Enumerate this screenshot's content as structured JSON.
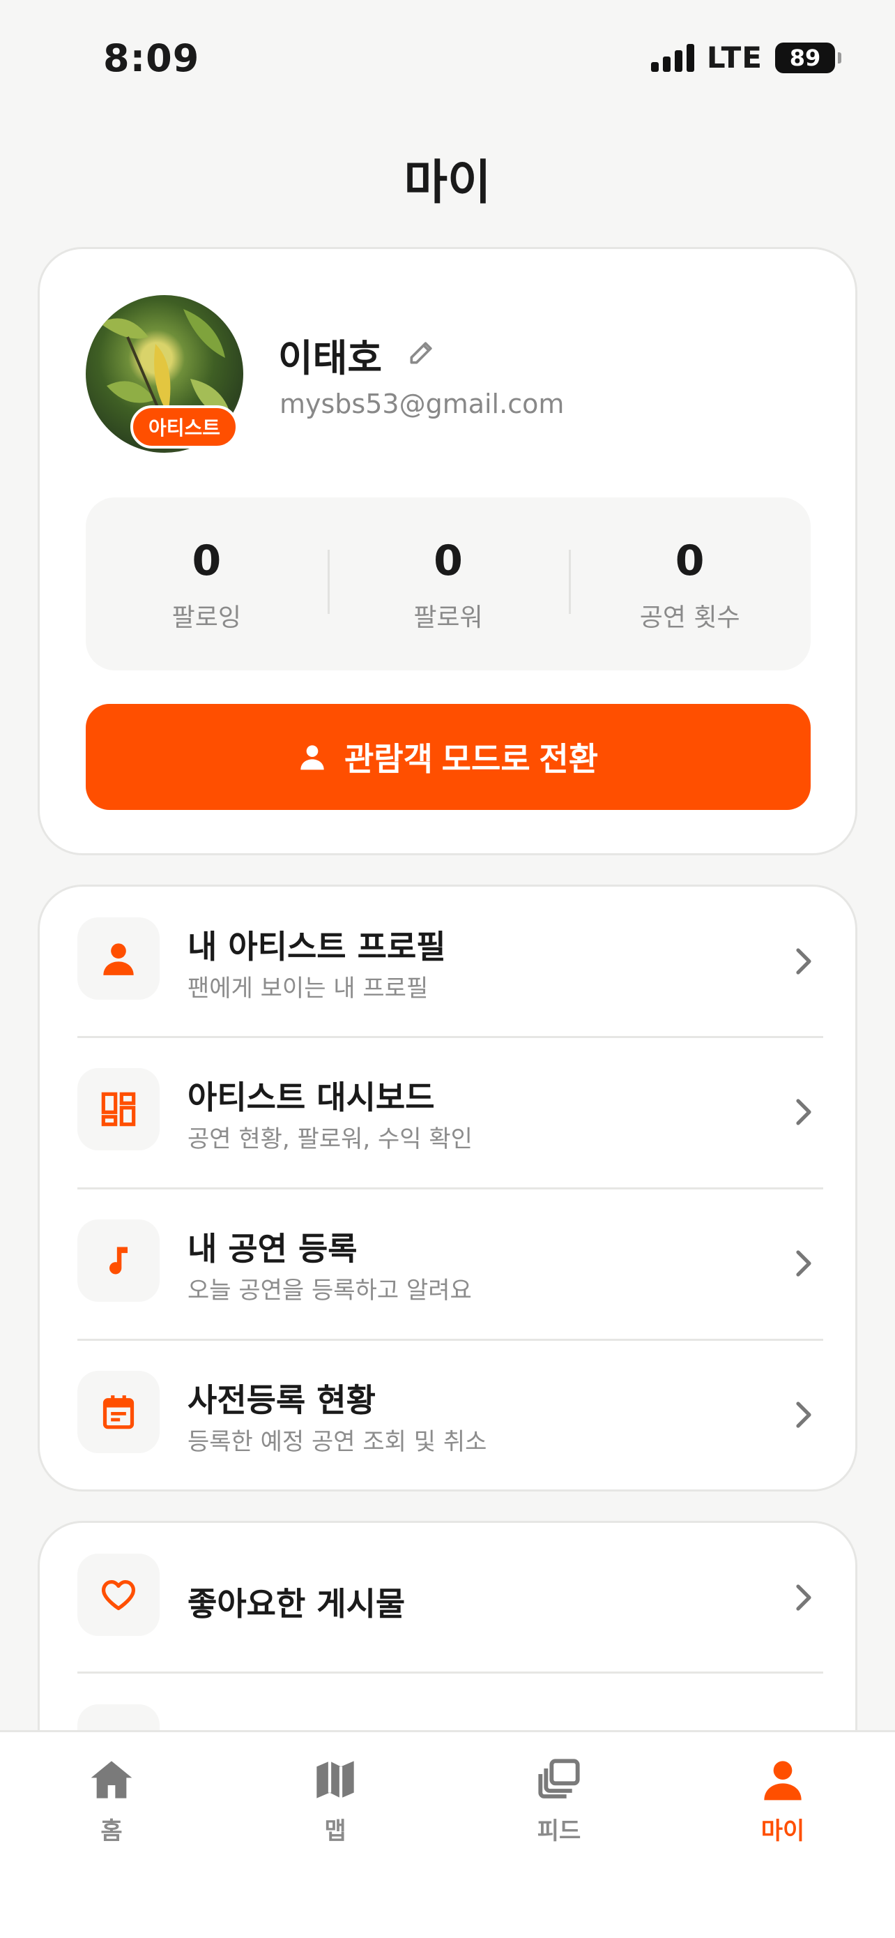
{
  "status_bar": {
    "time": "8:09",
    "network": "LTE",
    "battery": "89"
  },
  "page_title": "마이",
  "profile": {
    "name": "이태호",
    "email": "mysbs53@gmail.com",
    "badge": "아티스트"
  },
  "stats": [
    {
      "value": "0",
      "label": "팔로잉"
    },
    {
      "value": "0",
      "label": "팔로워"
    },
    {
      "value": "0",
      "label": "공연 횟수"
    }
  ],
  "mode_button": {
    "label": "관람객 모드로 전환"
  },
  "artist_menu": [
    {
      "title": "내 아티스트 프로필",
      "subtitle": "팬에게 보이는 내 프로필",
      "icon": "person-icon"
    },
    {
      "title": "아티스트 대시보드",
      "subtitle": "공연 현황, 팔로워, 수익 확인",
      "icon": "dashboard-icon"
    },
    {
      "title": "내 공연 등록",
      "subtitle": "오늘 공연을 등록하고 알려요",
      "icon": "music-note-icon"
    },
    {
      "title": "사전등록 현황",
      "subtitle": "등록한 예정 공연 조회 및 취소",
      "icon": "calendar-icon"
    }
  ],
  "general_menu": [
    {
      "title": "좋아요한 게시물",
      "icon": "heart-icon"
    }
  ],
  "tab_bar": {
    "tabs": [
      {
        "label": "홈",
        "icon": "home-icon",
        "active": false
      },
      {
        "label": "맵",
        "icon": "map-icon",
        "active": false
      },
      {
        "label": "피드",
        "icon": "feed-icon",
        "active": false
      },
      {
        "label": "마이",
        "icon": "person-icon",
        "active": true
      }
    ]
  },
  "colors": {
    "accent": "#ff4f00",
    "background": "#f6f6f5",
    "card": "#ffffff",
    "muted_text": "#8a8a8a"
  }
}
